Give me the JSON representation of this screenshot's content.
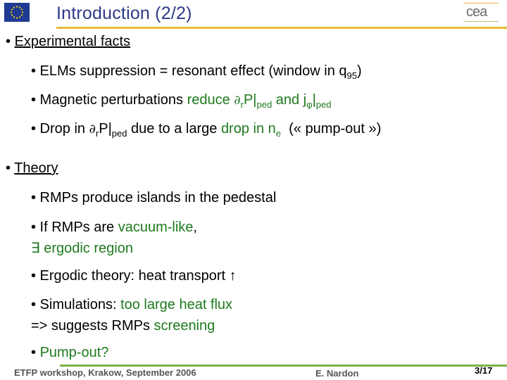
{
  "header": {
    "title": "Introduction (2/2)",
    "logo_right_text": "cea",
    "logo_left": "eu-flag-icon"
  },
  "colors": {
    "title": "#2e3a87",
    "accent_gold": "#e8b83a",
    "accent_green_rule": "#7ab24a",
    "highlight_green": "#1e7a1e",
    "footer_text": "#555555"
  },
  "sections": {
    "experimental": {
      "bullet": "•",
      "heading": "Experimental facts",
      "items": {
        "elms": {
          "text": "• ELMs suppression = resonant effect (window in q",
          "sub": "95",
          "after": ")"
        },
        "magnetic": {
          "lead": "• Magnetic perturbations ",
          "green1": "reduce ",
          "partial": "∂",
          "sub_r": "r",
          "p": "P|",
          "sub_ped1": "ped",
          "and": " and j",
          "sub_phi": "φ",
          "bar": "|",
          "sub_ped2": "ped"
        },
        "drop": {
          "lead": "• Drop in ",
          "partial": "∂",
          "sub_r": "r",
          "p": "P|",
          "sub_ped": "ped",
          "mid": " due to a large ",
          "green": "drop in n",
          "sub_e": "e",
          "tail": "  (« pump-out »)"
        }
      }
    },
    "theory": {
      "bullet": "•",
      "heading": "Theory",
      "items": {
        "rmps_islands": "• RMPs produce islands in the pedestal",
        "vacuum": {
          "lead": "• If RMPs are ",
          "green": "vacuum-like",
          "comma": ",",
          "line2": "∃ ergodic region"
        },
        "ergodic": {
          "text": "• Ergodic theory: heat transport ",
          "arrow": "↑"
        },
        "simulations": {
          "lead": "• Simulations: ",
          "green": "too large heat flux",
          "line2_lead": "=> suggests RMPs ",
          "line2_green": "screening"
        },
        "pumpout": {
          "bullet": "• ",
          "green": "Pump-out?"
        }
      }
    }
  },
  "footer": {
    "event": "ETFP workshop, Krakow, September 2006",
    "author": "E. Nardon",
    "page": "3/17"
  }
}
